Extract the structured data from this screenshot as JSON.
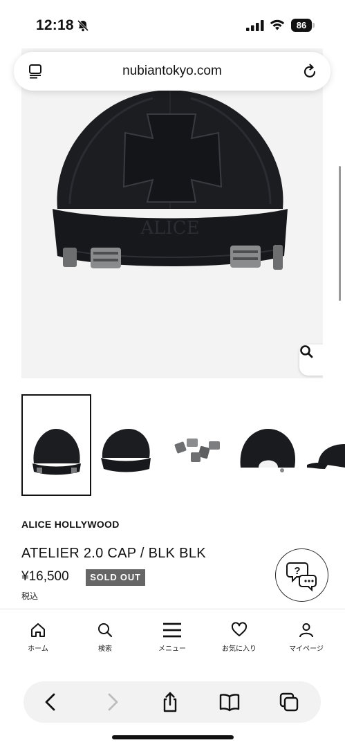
{
  "status_bar": {
    "time": "12:18",
    "battery": "86",
    "icons": [
      "bell-slash-icon",
      "cellular-signal-icon",
      "wifi-icon",
      "battery-icon"
    ]
  },
  "address_bar": {
    "url": "nubiantokyo.com",
    "left_icon": "reader-icon",
    "right_icon": "reload-icon"
  },
  "hero": {
    "alt_subject": "black cap with cross patch and metal clips",
    "zoom_icon": "magnifier-icon"
  },
  "thumbnails": {
    "selected_index": 0,
    "items": [
      "cap-front",
      "cap-angle",
      "metal-clips",
      "cap-back",
      "cap-side"
    ]
  },
  "product": {
    "brand": "ALICE HOLLYWOOD",
    "name": "ATELIER 2.0 CAP / BLK BLK",
    "price": "¥16,500",
    "status_badge": "SOLD OUT",
    "tax_note": "税込"
  },
  "chat_button": {
    "icon": "chat-help-icon"
  },
  "bottom_nav": {
    "items": [
      {
        "label": "ホーム",
        "icon": "home-icon"
      },
      {
        "label": "検索",
        "icon": "search-icon"
      },
      {
        "label": "メニュー",
        "icon": "menu-icon"
      },
      {
        "label": "お気に入り",
        "icon": "heart-icon"
      },
      {
        "label": "マイページ",
        "icon": "user-icon"
      }
    ]
  },
  "safari_toolbar": {
    "items": [
      "back-icon",
      "forward-icon",
      "share-icon",
      "bookmarks-icon",
      "tabs-icon"
    ]
  },
  "colors": {
    "badge_bg": "#666666",
    "hero_bg": "#f3f3f3",
    "text": "#111111"
  }
}
